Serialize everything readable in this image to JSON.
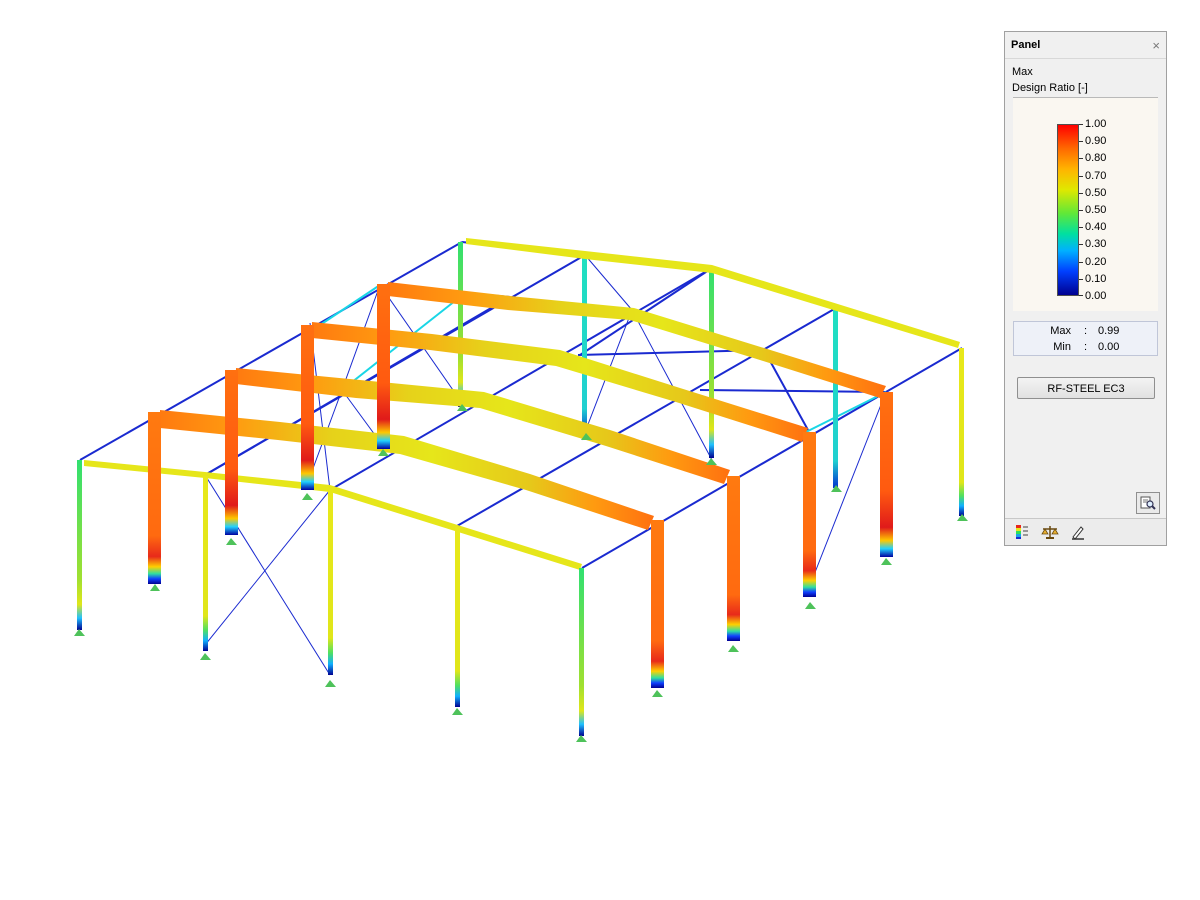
{
  "panel": {
    "title": "Panel",
    "close_glyph": "×",
    "result_type": "Max",
    "quantity": "Design Ratio [-]",
    "scale_labels": [
      "1.00",
      "0.90",
      "0.80",
      "0.70",
      "0.50",
      "0.50",
      "0.40",
      "0.30",
      "0.20",
      "0.10",
      "0.00"
    ],
    "max_label": "Max",
    "max_value": "0.99",
    "min_label": "Min",
    "min_value": "0.00",
    "separator": ":",
    "module_button": "RF-STEEL EC3",
    "zoom_icon": "zoom-search-icon",
    "tabs": [
      "color-scale-icon",
      "balance-icon",
      "filter-pencil-icon"
    ]
  },
  "colors": {
    "ratio_red": "#e8261a",
    "ratio_orange": "#ff7a10",
    "ratio_yellow": "#e6e61a",
    "ratio_green": "#2ee05a",
    "ratio_cyan": "#19d6e6",
    "ratio_blue": "#1a2ad0",
    "support_green": "#4ec25a"
  }
}
